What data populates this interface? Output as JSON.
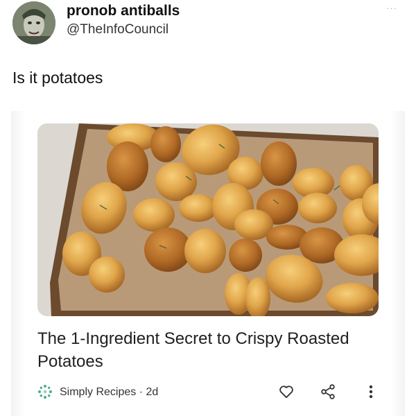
{
  "author": {
    "name": "pronob antiballs",
    "handle": "@TheInfoCouncil",
    "menu_glyph": "···"
  },
  "tweet": {
    "text": "Is it potatoes"
  },
  "card": {
    "image_icon": "roasted-potatoes-photo",
    "title": "The 1-Ingredient Secret to Crispy Roasted Potatoes",
    "source_name": "Simply Recipes",
    "age": "2d",
    "source_line": "Simply Recipes · 2d",
    "actions": {
      "like_icon": "heart-icon",
      "share_icon": "share-icon",
      "more_icon": "more-vertical-icon",
      "more_glyph": "⋮"
    }
  },
  "colors": {
    "background": "#ffffff",
    "text_primary": "#111111",
    "source_icon_green": "#4caf8a"
  }
}
